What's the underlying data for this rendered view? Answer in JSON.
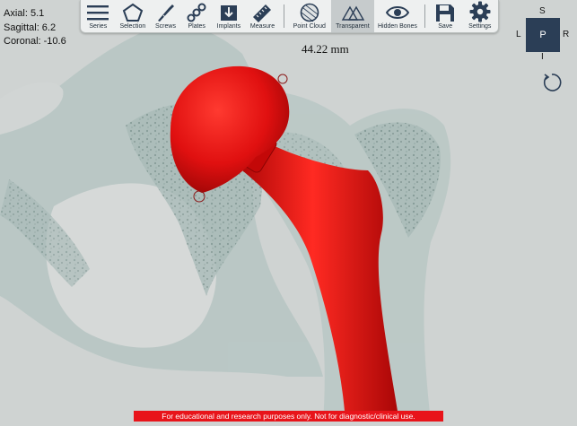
{
  "coords": {
    "axial": "Axial: 5.1",
    "sagittal": "Sagittal: 6.2",
    "coronal": "Coronal: -10.6"
  },
  "toolbar": {
    "series": "Series",
    "selection": "Selection",
    "screws": "Screws",
    "plates": "Plates",
    "implants": "Implants",
    "measure": "Measure",
    "point_cloud": "Point Cloud",
    "transparent": "Transparent",
    "hidden_bones": "Hidden Bones",
    "save": "Save",
    "settings": "Settings"
  },
  "measurement": "44.22 mm",
  "orientation": {
    "top": "S",
    "left": "L",
    "center": "P",
    "right": "R",
    "bottom": "I"
  },
  "footer": "For educational and research purposes only. Not for diagnostic/clinical use.",
  "colors": {
    "implant": "#e01010",
    "bone": "#8fa8a4",
    "background": "#cfd3d2",
    "footer": "#e8141a",
    "toolbar_icon": "#2b3e56"
  },
  "icons": [
    "list-icon",
    "pentagon-selection-icon",
    "scalpel-icon",
    "chain-plate-icon",
    "download-implant-icon",
    "ruler-icon",
    "point-cloud-icon",
    "transparent-icon",
    "eye-icon",
    "save-disk-icon",
    "gear-icon",
    "rotate-icon"
  ]
}
